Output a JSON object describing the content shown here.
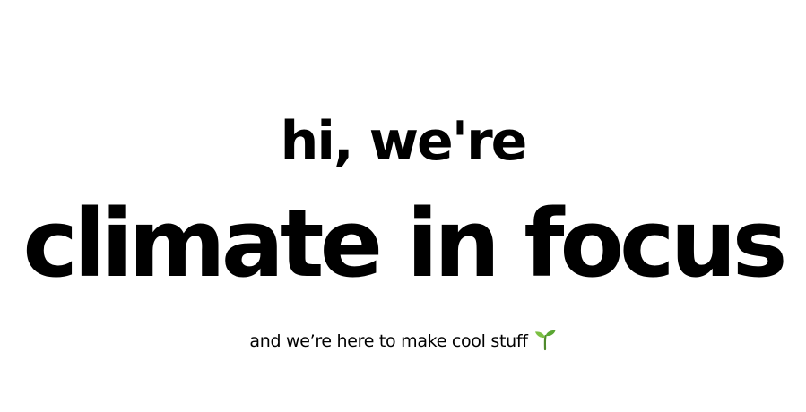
{
  "hero": {
    "greeting": "hi, we're",
    "brand_name": "climate in focus",
    "tagline": "and we’re here to make cool stuff",
    "tagline_icon": "seedling-icon"
  },
  "colors": {
    "background": "#ffffff",
    "text": "#000000",
    "sprout_stem": "#4f8a2c",
    "sprout_leaf": "#7cc043"
  }
}
